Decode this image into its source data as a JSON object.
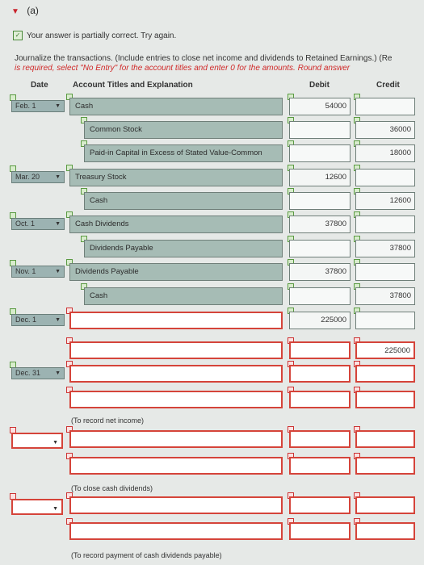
{
  "section": {
    "marker": "▼",
    "label": "(a)"
  },
  "feedback": "Your answer is partially correct.  Try again.",
  "instructions": {
    "line1": "Journalize the transactions. (Include entries to close net income and dividends to Retained Earnings.) (Re",
    "line2": "is required, select \"No Entry\" for the account titles and enter 0 for the amounts. Round answer"
  },
  "headers": {
    "date": "Date",
    "account": "Account Titles and Explanation",
    "debit": "Debit",
    "credit": "Credit"
  },
  "rows": [
    {
      "date": "Feb. 1",
      "account": "Cash",
      "debit": "54000",
      "credit": ""
    },
    {
      "date": "",
      "account": "Common Stock",
      "debit": "",
      "credit": "36000"
    },
    {
      "date": "",
      "account": "Paid-in Capital in Excess of Stated Value-Common",
      "debit": "",
      "credit": "18000"
    },
    {
      "date": "Mar. 20",
      "account": "Treasury Stock",
      "debit": "12600",
      "credit": ""
    },
    {
      "date": "",
      "account": "Cash",
      "debit": "",
      "credit": "12600"
    },
    {
      "date": "Oct. 1",
      "account": "Cash Dividends",
      "debit": "37800",
      "credit": ""
    },
    {
      "date": "",
      "account": "Dividends Payable",
      "debit": "",
      "credit": "37800"
    },
    {
      "date": "Nov. 1",
      "account": "Dividends Payable",
      "debit": "37800",
      "credit": ""
    },
    {
      "date": "",
      "account": "Cash",
      "debit": "",
      "credit": "37800"
    },
    {
      "date": "Dec. 1",
      "account": "",
      "debit": "225000",
      "credit": ""
    },
    {
      "date": "",
      "account": "",
      "debit": "",
      "credit": "225000"
    },
    {
      "date": "Dec. 31",
      "account": "",
      "debit": "",
      "credit": ""
    },
    {
      "date": "",
      "account": "",
      "debit": "",
      "credit": ""
    },
    {
      "date": "",
      "account": "",
      "debit": "",
      "credit": ""
    },
    {
      "date": "",
      "account": "",
      "debit": "",
      "credit": ""
    },
    {
      "date": "",
      "account": "",
      "debit": "",
      "credit": ""
    },
    {
      "date": "",
      "account": "",
      "debit": "",
      "credit": ""
    }
  ],
  "notes": {
    "net_income": "(To record net income)",
    "close_dividends": "(To close cash dividends)",
    "payment": "(To record payment of cash dividends payable)"
  }
}
